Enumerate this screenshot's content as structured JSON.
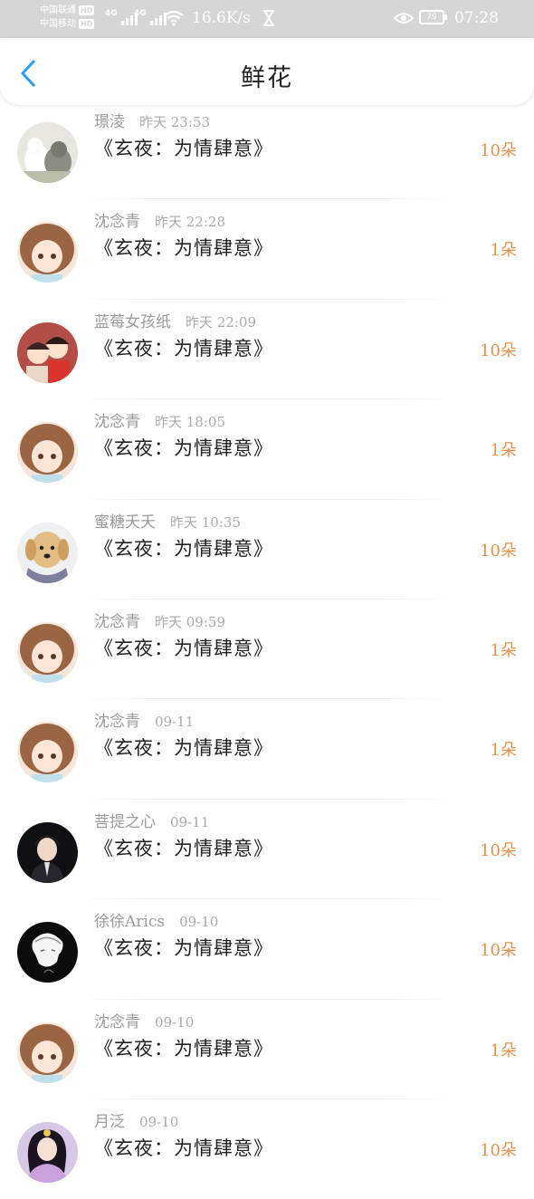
{
  "status_bar": {
    "carrier1": "中国联通",
    "carrier2": "中国移动",
    "hd_badge": "HD",
    "network_gen": "4G",
    "speed": "16.6K/s",
    "battery": "79",
    "time": "07:28"
  },
  "header": {
    "title": "鲜花",
    "back_icon": "chevron-left-icon",
    "accent_color": "#2b9cf0"
  },
  "count_color": "#e6914e",
  "items": [
    {
      "name": "璟淩",
      "time": "昨天 23:53",
      "book": "《玄夜：为情肆意》",
      "count": "10朵",
      "avatar": "cats-avatar"
    },
    {
      "name": "沈念青",
      "time": "昨天 22:28",
      "book": "《玄夜：为情肆意》",
      "count": "1朵",
      "avatar": "anime-girl-avatar"
    },
    {
      "name": "蓝莓女孩纸",
      "time": "昨天 22:09",
      "book": "《玄夜：为情肆意》",
      "count": "10朵",
      "avatar": "anime-couple-avatar"
    },
    {
      "name": "沈念青",
      "time": "昨天 18:05",
      "book": "《玄夜：为情肆意》",
      "count": "1朵",
      "avatar": "anime-girl-avatar"
    },
    {
      "name": "蜜糖夭夭",
      "time": "昨天 10:35",
      "book": "《玄夜：为情肆意》",
      "count": "10朵",
      "avatar": "dog-avatar"
    },
    {
      "name": "沈念青",
      "time": "昨天 09:59",
      "book": "《玄夜：为情肆意》",
      "count": "1朵",
      "avatar": "anime-girl-avatar"
    },
    {
      "name": "沈念青",
      "time": "09-11",
      "book": "《玄夜：为情肆意》",
      "count": "1朵",
      "avatar": "anime-girl-avatar"
    },
    {
      "name": "菩提之心",
      "time": "09-11",
      "book": "《玄夜：为情肆意》",
      "count": "10朵",
      "avatar": "man-photo-avatar"
    },
    {
      "name": "徐徐Arics",
      "time": "09-10",
      "book": "《玄夜：为情肆意》",
      "count": "10朵",
      "avatar": "sketch-avatar"
    },
    {
      "name": "沈念青",
      "time": "09-10",
      "book": "《玄夜：为情肆意》",
      "count": "1朵",
      "avatar": "anime-girl-avatar"
    },
    {
      "name": "月泛",
      "time": "09-10",
      "book": "《玄夜：为情肆意》",
      "count": "10朵",
      "avatar": "costume-girl-avatar"
    }
  ]
}
